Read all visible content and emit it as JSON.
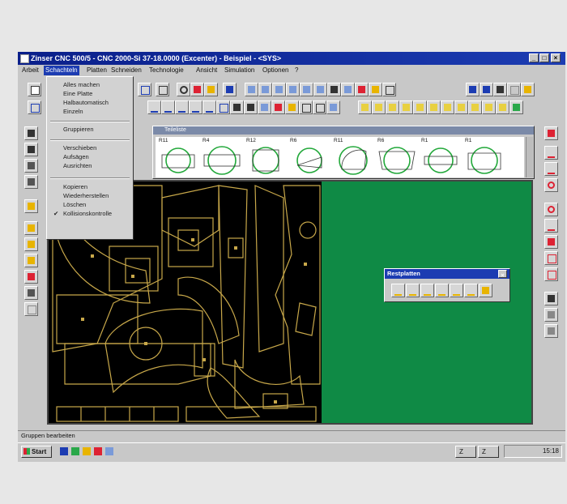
{
  "window": {
    "title": "Zinser CNC 500/5 - CNC 2000-Si 37-18.0000 (Excenter) - Beispiel - <SYS>",
    "min": "_",
    "max": "□",
    "close": "×"
  },
  "menubar": {
    "items": [
      "Arbeit",
      "Schachteln",
      "Platten",
      "Schneiden",
      "Technologie",
      "Ansicht",
      "Simulation",
      "Optionen",
      "?"
    ]
  },
  "dropdown": {
    "items": [
      "Alles machen",
      "Eine Platte",
      "Halbautomatisch",
      "Einzeln",
      "Gruppieren",
      "Verschieben",
      "Aufsägen",
      "Ausrichten",
      "Kopieren",
      "Wiederherstellen",
      "Löschen",
      "Kollisionskontrolle"
    ],
    "checked": "Kollisionskontrolle"
  },
  "library": {
    "title": "Teileliste",
    "cells": [
      "R11",
      "R4",
      "R12",
      "R6",
      "R11",
      "R6",
      "R1",
      "R1"
    ]
  },
  "restplatten": {
    "title": "Restplatten",
    "close": "×"
  },
  "status": {
    "text": "Gruppen bearbeiten"
  },
  "taskbar": {
    "start": "Start",
    "clock": "15:18",
    "task1": "Z",
    "task2": "Z"
  },
  "colors": {
    "titlebar": "#1c3cb2",
    "canvas": "#000000",
    "plate": "#0f8a45",
    "parts": "#c8a84a",
    "library_shapes": "#22a83a"
  }
}
